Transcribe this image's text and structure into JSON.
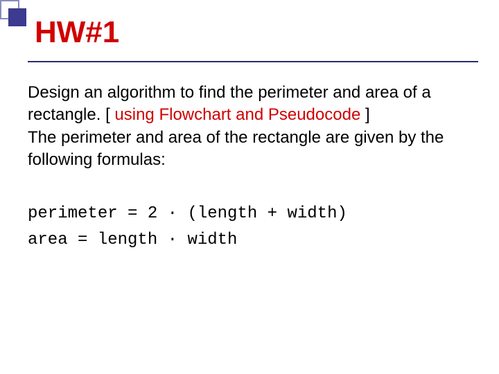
{
  "title": "HW#1",
  "para1_a": "Design an algorithm to find the perimeter and area of a rectangle. [ ",
  "para1_red": "using Flowchart and Pseudocode",
  "para1_b": " ]",
  "para2": "The perimeter and area of the rectangle are given by the following formulas:",
  "formula1": "perimeter = 2 · (length + width)",
  "formula2": "area = length · width"
}
